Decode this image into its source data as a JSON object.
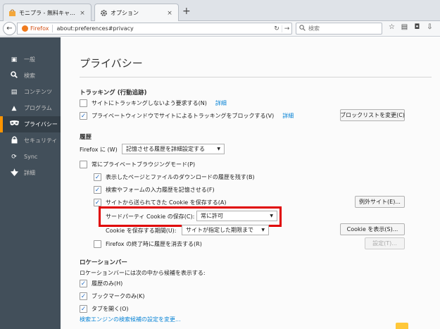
{
  "tabs": [
    {
      "title": "モニプラ - 無料キャンペーン...",
      "close": "×"
    },
    {
      "title": "オプション",
      "close": "×"
    }
  ],
  "new_tab": "+",
  "nav": {
    "back": "←",
    "identity": "Firefox",
    "url": "about:preferences#privacy",
    "reload": "↻",
    "go": "→",
    "search_placeholder": "検索",
    "search_icon": "search-icon",
    "toolbar_icons": [
      "star",
      "reading-list",
      "pocket",
      "download",
      "menu"
    ]
  },
  "sidebar": {
    "items": [
      {
        "label": "一般",
        "icon": "general-icon"
      },
      {
        "label": "検索",
        "icon": "search-icon"
      },
      {
        "label": "コンテンツ",
        "icon": "content-icon"
      },
      {
        "label": "プログラム",
        "icon": "applications-icon"
      },
      {
        "label": "プライバシー",
        "icon": "privacy-mask-icon"
      },
      {
        "label": "セキュリティ",
        "icon": "lock-icon"
      },
      {
        "label": "Sync",
        "icon": "sync-icon"
      },
      {
        "label": "詳細",
        "icon": "advanced-icon"
      }
    ],
    "active_index": 4
  },
  "main": {
    "title": "プライバシー",
    "tracking": {
      "heading": "トラッキング (行動追跡)",
      "dnt_label": "サイトにトラッキングしないよう要求する(N)",
      "dnt_checked": false,
      "dnt_link": "詳細",
      "pb_label": "プライベートウィンドウでサイトによるトラッキングをブロックする(V)",
      "pb_checked": true,
      "pb_link": "詳細",
      "blocklist_button": "ブロックリストを変更(C)"
    },
    "history": {
      "heading": "履歴",
      "firefox_prefix": "Firefox に (W)",
      "history_select": "記憶させる履歴を詳細設定する",
      "always_private": "常にプライベートブラウジングモード(P)",
      "always_private_checked": false,
      "remember_browsing": "表示したページとファイルのダウンロードの履歴を残す(B)",
      "remember_browsing_checked": true,
      "remember_search": "検索やフォームの入力履歴を記憶させる(F)",
      "remember_search_checked": true,
      "accept_cookies": "サイトから送られてきた Cookie を保存する(A)",
      "accept_cookies_checked": true,
      "exceptions_button": "例外サイト(E)...",
      "third_party_label": "サードパーティ Cookie の保存(C):",
      "third_party_select": "常に許可",
      "keep_until_label": "Cookie を保存する期間(U):",
      "keep_until_select": "サイトが指定した期限まで",
      "show_cookies_button": "Cookie を表示(S)...",
      "clear_on_close": "Firefox の終了時に履歴を消去する(R)",
      "clear_on_close_checked": false,
      "settings_button": "設定(T)..."
    },
    "location_bar": {
      "heading": "ロケーションバー",
      "description": "ロケーションバーには次の中から候補を表示する:",
      "history_only": "履歴のみ(H)",
      "history_checked": true,
      "bookmarks_only": "ブックマークのみ(K)",
      "bookmarks_checked": true,
      "open_tabs": "タブを開く(O)",
      "open_tabs_checked": true,
      "search_engine_link": "検索エンジンの検索候補の設定を変更..."
    }
  },
  "colors": {
    "sidebar_bg": "#424f5a",
    "active_accent": "#ff9500",
    "link": "#0a84d6",
    "highlight_box": "#e00000"
  }
}
